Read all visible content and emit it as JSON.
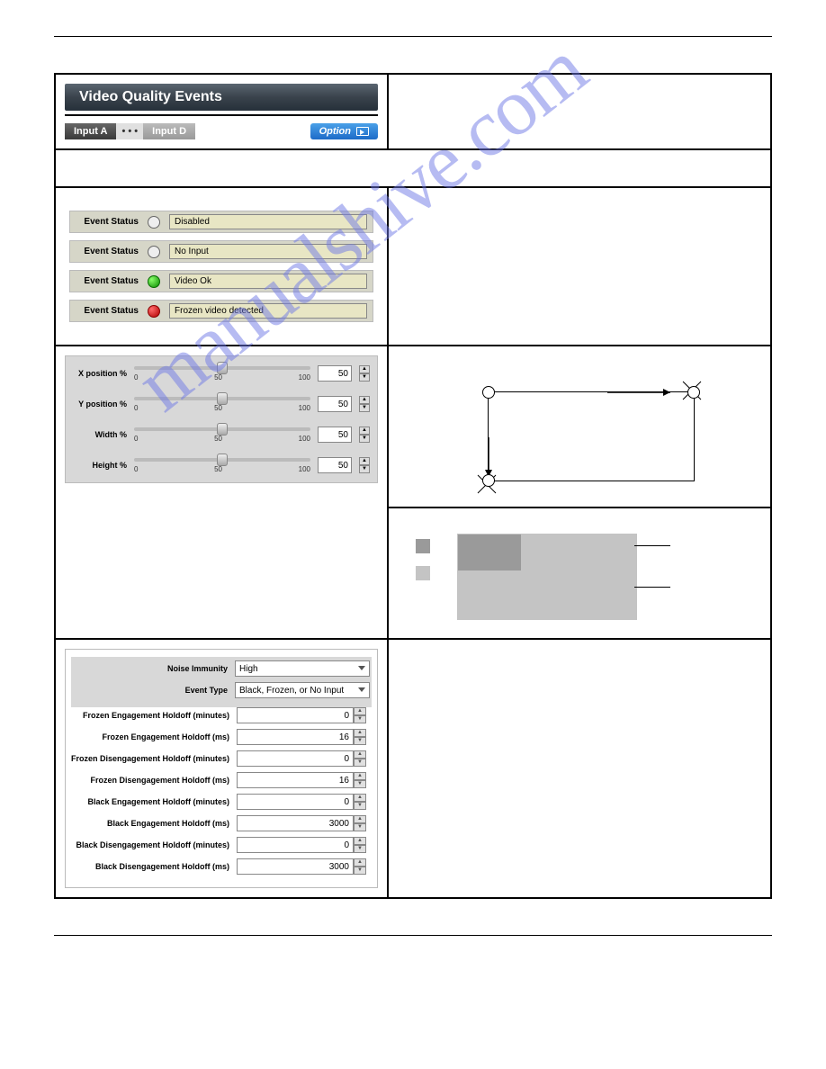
{
  "header": {
    "banner_title": "Video Quality Events",
    "tab_a": "Input A",
    "tab_dots": "• • •",
    "tab_d": "Input D",
    "option_label": "Option"
  },
  "event_status": {
    "label": "Event Status",
    "disabled": "Disabled",
    "no_input": "No Input",
    "video_ok": "Video Ok",
    "frozen": "Frozen video detected"
  },
  "sliders": {
    "x_label": "X position %",
    "y_label": "Y position %",
    "w_label": "Width %",
    "h_label": "Height %",
    "tick0": "0",
    "tick50": "50",
    "tick100": "100",
    "x_val": "50",
    "y_val": "50",
    "w_val": "50",
    "h_val": "50"
  },
  "settings": {
    "noise_immunity_label": "Noise Immunity",
    "noise_immunity_value": "High",
    "event_type_label": "Event Type",
    "event_type_value": "Black, Frozen, or No Input",
    "rows": [
      {
        "label": "Frozen Engagement Holdoff (minutes)",
        "value": "0"
      },
      {
        "label": "Frozen Engagement Holdoff (ms)",
        "value": "16"
      },
      {
        "label": "Frozen Disengagement Holdoff (minutes)",
        "value": "0"
      },
      {
        "label": "Frozen Disengagement Holdoff (ms)",
        "value": "16"
      },
      {
        "label": "Black Engagement Holdoff (minutes)",
        "value": "0"
      },
      {
        "label": "Black Engagement Holdoff (ms)",
        "value": "3000"
      },
      {
        "label": "Black Disengagement Holdoff (minutes)",
        "value": "0"
      },
      {
        "label": "Black Disengagement Holdoff (ms)",
        "value": "3000"
      }
    ]
  },
  "watermark": "manualshive.com"
}
